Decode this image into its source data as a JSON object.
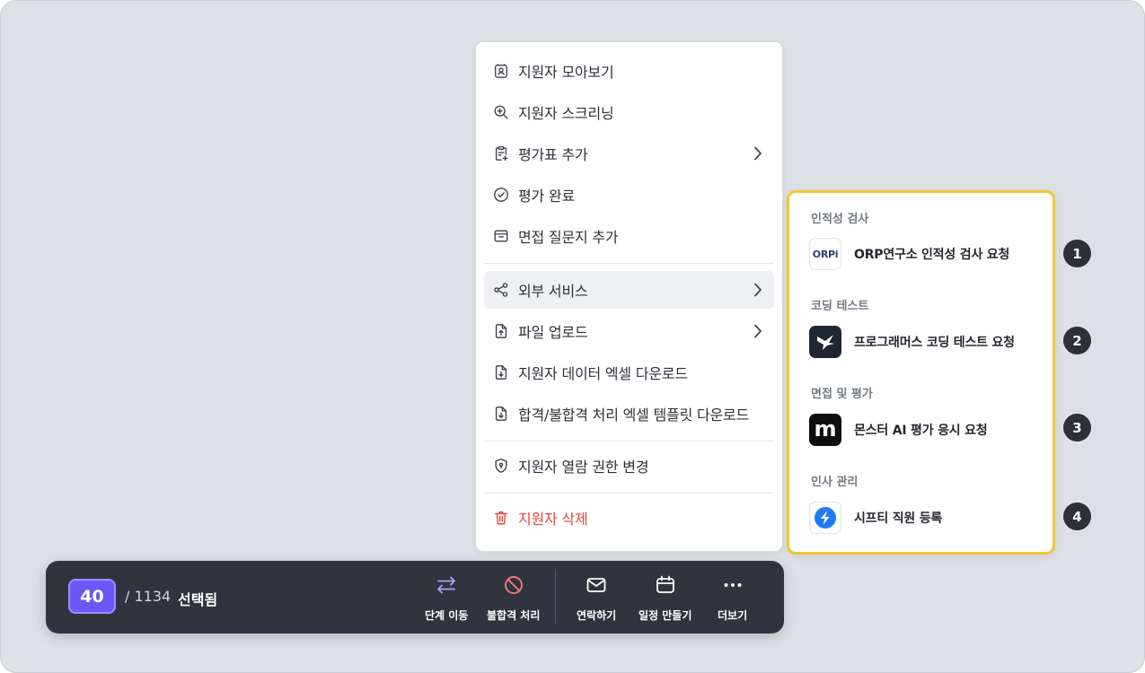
{
  "menu": {
    "items": [
      {
        "label": "지원자 모아보기",
        "icon": "contact-card-icon"
      },
      {
        "label": "지원자 스크리닝",
        "icon": "search-plus-icon"
      },
      {
        "label": "평가표 추가",
        "icon": "clipboard-add-icon",
        "submenu": true
      },
      {
        "label": "평가 완료",
        "icon": "check-circle-icon"
      },
      {
        "label": "면접 질문지 추가",
        "icon": "archive-icon"
      },
      {
        "label": "외부 서비스",
        "icon": "share-icon",
        "submenu": true,
        "active": true
      },
      {
        "label": "파일 업로드",
        "icon": "file-upload-icon",
        "submenu": true
      },
      {
        "label": "지원자 데이터 엑셀 다운로드",
        "icon": "file-download-icon"
      },
      {
        "label": "합격/불합격 처리 엑셀 템플릿 다운로드",
        "icon": "file-download-icon"
      },
      {
        "label": "지원자 열람 권한 변경",
        "icon": "shield-lock-icon"
      },
      {
        "label": "지원자 삭제",
        "icon": "trash-icon",
        "danger": true
      }
    ]
  },
  "submenu": {
    "sections": [
      {
        "title": "인적성 검사",
        "service": "ORP연구소 인적성 검사 요청",
        "logo_text": "ORPi",
        "logo": "orp-logo"
      },
      {
        "title": "코딩 테스트",
        "service": "프로그래머스 코딩 테스트 요청",
        "logo": "programmers-logo"
      },
      {
        "title": "면접 및 평가",
        "service": "몬스터 AI 평가 응시 요청",
        "logo_text": "m",
        "logo": "monster-logo"
      },
      {
        "title": "인사 관리",
        "service": "시프티 직원 등록",
        "logo": "shiftee-logo"
      }
    ],
    "markers": [
      "1",
      "2",
      "3",
      "4"
    ],
    "highlight_color": "#f4c430"
  },
  "bottom_bar": {
    "selected_count": "40",
    "total": "/ 1134",
    "selected_label": "선택됨",
    "actions": [
      {
        "label": "단계 이동",
        "icon": "swap-arrows-icon",
        "color": "#a9a0ff"
      },
      {
        "label": "불합격 처리",
        "icon": "ban-icon",
        "color": "#f07a7a"
      },
      {
        "label": "연락하기",
        "icon": "mail-icon",
        "color": "#ffffff"
      },
      {
        "label": "일정 만들기",
        "icon": "calendar-icon",
        "color": "#ffffff"
      },
      {
        "label": "더보기",
        "icon": "more-dots-icon",
        "color": "#ffffff"
      }
    ]
  }
}
